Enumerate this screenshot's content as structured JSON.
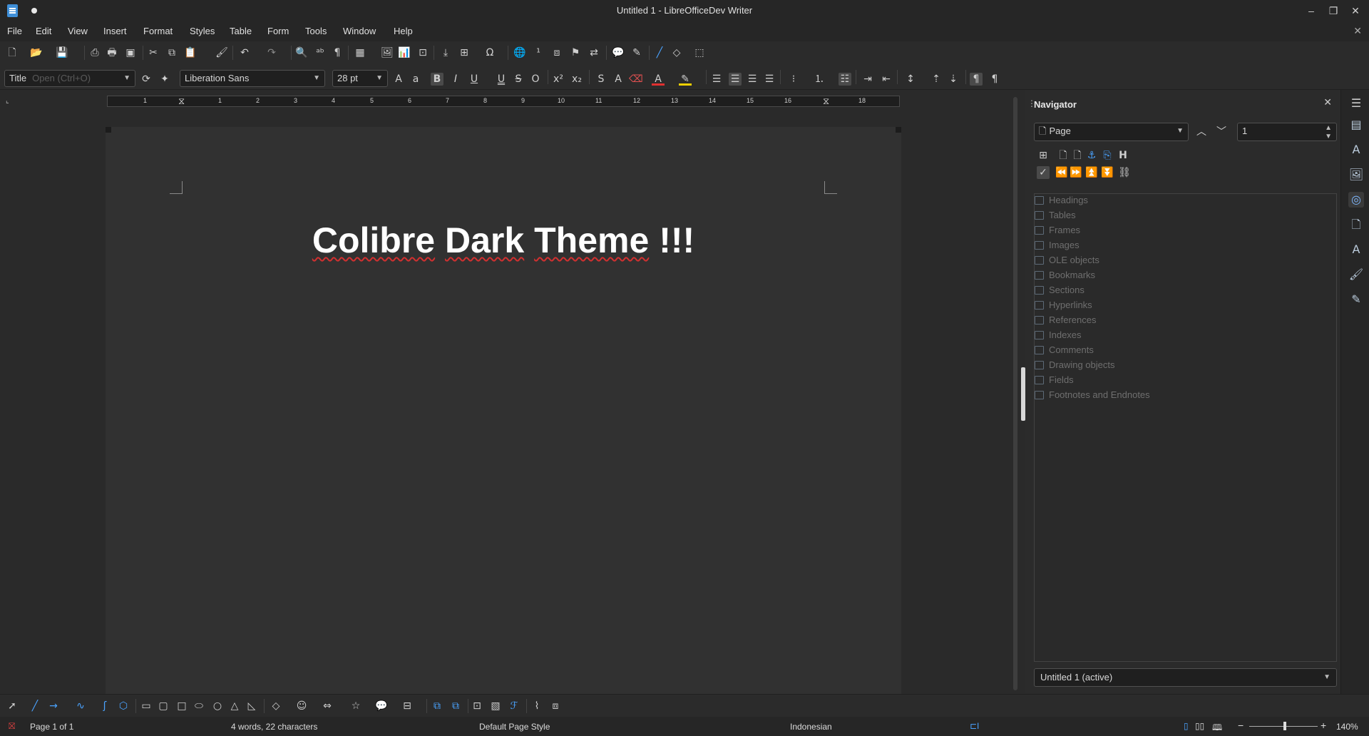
{
  "window": {
    "title": "Untitled 1 - LibreOfficeDev Writer",
    "minimize": "–",
    "restore": "❐",
    "close": "✕"
  },
  "menubar": {
    "items": [
      "File",
      "Edit",
      "View",
      "Insert",
      "Format",
      "Styles",
      "Table",
      "Form",
      "Tools",
      "Window",
      "Help"
    ],
    "close_doc": "✕"
  },
  "formatting": {
    "paragraph_style": "Title",
    "paragraph_style_hint": "Open (Ctrl+O)",
    "font_name": "Liberation Sans",
    "font_size": "28 pt"
  },
  "ruler": {
    "numbers": [
      "1",
      "1",
      "2",
      "3",
      "4",
      "5",
      "6",
      "7",
      "8",
      "9",
      "10",
      "11",
      "12",
      "13",
      "14",
      "15",
      "16",
      "18"
    ]
  },
  "document": {
    "title_text_1": "Colibre",
    "title_text_2": "Dark",
    "title_text_3": "Theme",
    "title_text_4": "!!!"
  },
  "navigator": {
    "header": "Navigator",
    "navigate_by": "Page",
    "page_number": "1",
    "tree_items": [
      "Headings",
      "Tables",
      "Frames",
      "Images",
      "OLE objects",
      "Bookmarks",
      "Sections",
      "Hyperlinks",
      "References",
      "Indexes",
      "Comments",
      "Drawing objects",
      "Fields",
      "Footnotes and Endnotes"
    ],
    "active_document": "Untitled 1 (active)"
  },
  "statusbar": {
    "page": "Page 1 of 1",
    "word_count": "4 words, 22 characters",
    "page_style": "Default Page Style",
    "language": "Indonesian",
    "zoom": "140%"
  },
  "colors": {
    "accent": "#3f8fd8",
    "background": "#2a2a2a",
    "page": "#313131",
    "spell_error": "#d23030"
  }
}
